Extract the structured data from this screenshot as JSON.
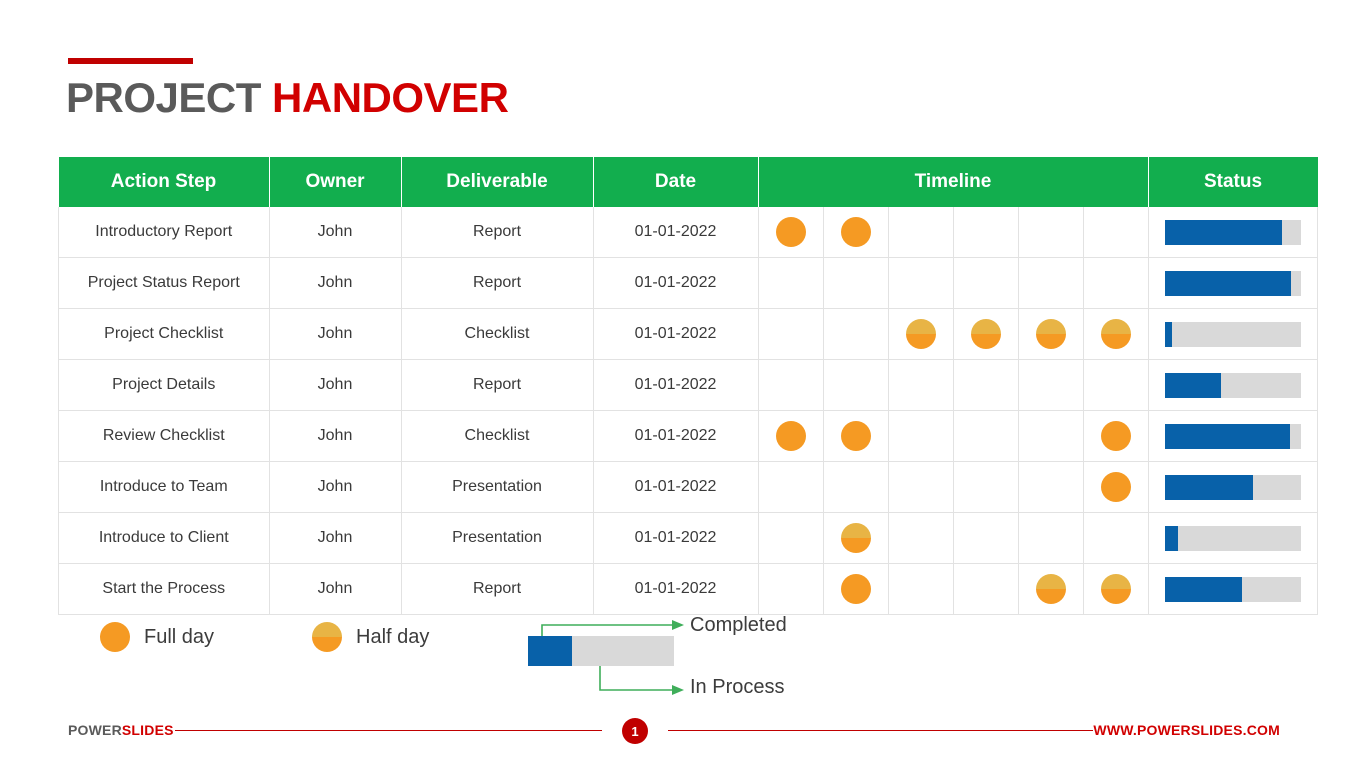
{
  "title": {
    "primary": "PROJECT",
    "accent": "HANDOVER"
  },
  "table": {
    "columns": [
      {
        "key": "action_step",
        "label": "Action Step"
      },
      {
        "key": "owner",
        "label": "Owner"
      },
      {
        "key": "deliverable",
        "label": "Deliverable"
      },
      {
        "key": "date",
        "label": "Date"
      },
      {
        "key": "timeline",
        "label": "Timeline"
      },
      {
        "key": "status",
        "label": "Status"
      }
    ],
    "timeline_slots": 6,
    "rows": [
      {
        "action_step": "Introductory Report",
        "owner": "John",
        "deliverable": "Report",
        "date": "01-01-2022",
        "timeline": [
          "full",
          "full",
          "",
          "",
          "",
          ""
        ],
        "status_percent": 86
      },
      {
        "action_step": "Project Status Report",
        "owner": "John",
        "deliverable": "Report",
        "date": "01-01-2022",
        "timeline": [
          "",
          "",
          "",
          "",
          "",
          ""
        ],
        "status_percent": 93
      },
      {
        "action_step": "Project Checklist",
        "owner": "John",
        "deliverable": "Checklist",
        "date": "01-01-2022",
        "timeline": [
          "",
          "",
          "half",
          "half",
          "half",
          "half"
        ],
        "status_percent": 5
      },
      {
        "action_step": "Project Details",
        "owner": "John",
        "deliverable": "Report",
        "date": "01-01-2022",
        "timeline": [
          "",
          "",
          "",
          "",
          "",
          ""
        ],
        "status_percent": 41
      },
      {
        "action_step": "Review Checklist",
        "owner": "John",
        "deliverable": "Checklist",
        "date": "01-01-2022",
        "timeline": [
          "full",
          "full",
          "",
          "",
          "",
          "full"
        ],
        "status_percent": 92
      },
      {
        "action_step": "Introduce to Team",
        "owner": "John",
        "deliverable": "Presentation",
        "date": "01-01-2022",
        "timeline": [
          "",
          "",
          "",
          "",
          "",
          "full"
        ],
        "status_percent": 65
      },
      {
        "action_step": "Introduce to Client",
        "owner": "John",
        "deliverable": "Presentation",
        "date": "01-01-2022",
        "timeline": [
          "",
          "half",
          "",
          "",
          "",
          ""
        ],
        "status_percent": 10
      },
      {
        "action_step": "Start the Process",
        "owner": "John",
        "deliverable": "Report",
        "date": "01-01-2022",
        "timeline": [
          "",
          "full",
          "",
          "",
          "half",
          "half"
        ],
        "status_percent": 57
      }
    ]
  },
  "legend": {
    "full_day_label": "Full day",
    "half_day_label": "Half day",
    "completed_label": "Completed",
    "in_process_label": "In Process",
    "bar_completed_percent": 30
  },
  "footer": {
    "brand_primary": "POWER",
    "brand_accent": "SLIDES",
    "page_number": "1",
    "url": "WWW.POWERSLIDES.COM"
  },
  "colors": {
    "header_green": "#12ae4e",
    "title_red": "#d10000",
    "title_gray": "#5a5a5a",
    "status_blue": "#0861a9",
    "status_gray": "#d9d9d9",
    "dot_orange": "#f59a23",
    "dot_gold": "#e8b445",
    "arrow_green": "#3fae5a"
  }
}
